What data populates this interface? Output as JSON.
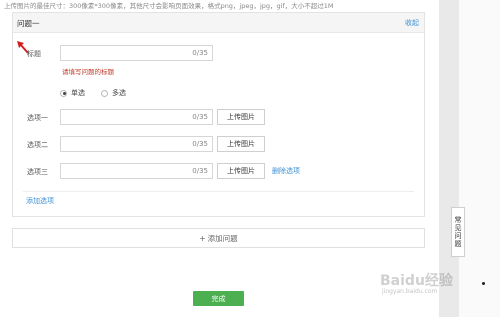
{
  "hint": "上传图片的最佳尺寸：300像素*300像素，其他尺寸会影响页面效果，格式png，jpeg，jpg，gif，大小不超过1M",
  "question": {
    "title": "问题一",
    "collapse": "收起",
    "title_label": "标题",
    "title_count": "0/35",
    "title_error": "请填写问题的标题",
    "single": "单选",
    "multi": "多选",
    "options": [
      {
        "label": "选项一",
        "count": "0/35",
        "upload": "上传图片"
      },
      {
        "label": "选项二",
        "count": "0/35",
        "upload": "上传图片"
      },
      {
        "label": "选项三",
        "count": "0/35",
        "upload": "上传图片",
        "delete": "删除选项"
      }
    ],
    "add_option": "添加选项"
  },
  "add_question": "添加问题",
  "add_question_prefix": "+",
  "done": "完成",
  "faq_chars": [
    "常",
    "见",
    "问",
    "题"
  ],
  "watermark": "Baidu经验",
  "watermark_url": "jingyan.baidu.com",
  "colors": {
    "accent": "#3b8fd6",
    "error": "#c0392b",
    "done": "#4caf50"
  }
}
